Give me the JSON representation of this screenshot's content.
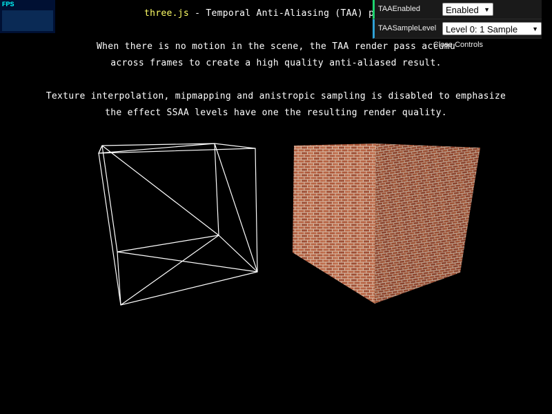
{
  "header": {
    "link_text": "three.js",
    "title_rest": " - Temporal Anti-Aliasing (TAA) pass by",
    "description_lines": [
      "When there is no motion in the scene, the TAA render pass accumu",
      "across frames to create a high quality anti-aliased result.",
      "Texture interpolation, mipmapping and anistropic sampling is disabled to emphasize",
      "the effect SSAA levels have one the resulting render quality."
    ]
  },
  "stats": {
    "label": "FPS"
  },
  "gui": {
    "controls": [
      {
        "label": "TAAEnabled",
        "value": "Enabled"
      },
      {
        "label": "TAASampleLevel",
        "value": "Level 0: 1 Sample"
      }
    ],
    "close_label": "Close Controls",
    "arrow_glyph": "▼"
  },
  "scene": {
    "wireframe_color": "#ffffff",
    "brick_color": "#c0704e",
    "mortar_color": "#e8d8c8"
  }
}
